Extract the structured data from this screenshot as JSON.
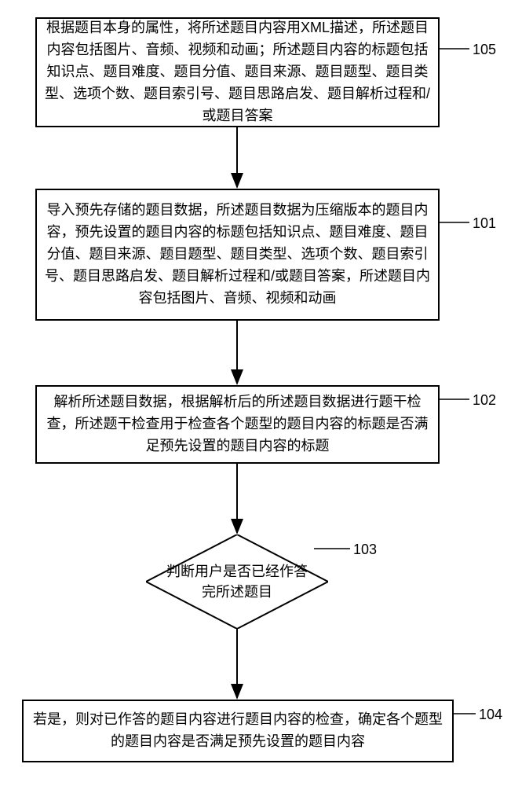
{
  "nodes": {
    "n105": {
      "text": "根据题目本身的属性，将所述题目内容用XML描述，所述题目内容包括图片、音频、视频和动画；所述题目内容的标题包括知识点、题目难度、题目分值、题目来源、题目题型、题目类型、选项个数、题目索引号、题目思路启发、题目解析过程和/或题目答案",
      "label": "105"
    },
    "n101": {
      "text": "导入预先存储的题目数据，所述题目数据为压缩版本的题目内容，预先设置的题目内容的标题包括知识点、题目难度、题目分值、题目来源、题目题型、题目类型、选项个数、题目索引号、题目思路启发、题目解析过程和/或题目答案，所述题目内容包括图片、音频、视频和动画",
      "label": "101"
    },
    "n102": {
      "text": "解析所述题目数据，根据解析后的所述题目数据进行题干检查，所述题干检查用于检查各个题型的题目内容的标题是否满足预先设置的题目内容的标题",
      "label": "102"
    },
    "n103": {
      "text": "判断用户是否已经作答完所述题目",
      "label": "103"
    },
    "n104": {
      "text": "若是，则对已作答的题目内容进行题目内容的检查，确定各个题型的题目内容是否满足预先设置的题目内容",
      "label": "104"
    }
  }
}
